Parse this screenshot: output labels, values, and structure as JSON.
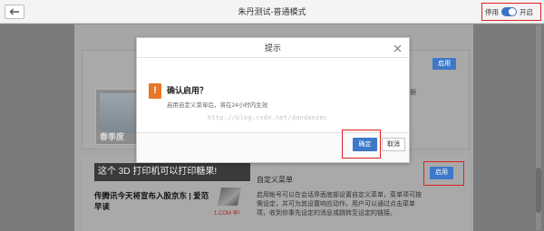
{
  "header": {
    "back_icon": "arrow-left-icon",
    "title": "朱丹测试-普通模式",
    "mode_off_label": "停用",
    "mode_on_label": "开启",
    "toggle_state": "on"
  },
  "cards": {
    "card1_button": "启用",
    "card1_image_caption": "春季度",
    "card1_trailing_text": "据",
    "card2": {
      "banner_text": "这个 3D 打印机可以打印糖果!",
      "news_title": "传腾讯今天将宣布入股京东 | 爱范早读",
      "logo_text": "1.COM 早!",
      "menu_title": "自定义菜单",
      "menu_description": "启用帐号可以在会话界面底部设置自定义菜单，菜单项可按需设定，并可为其设置响应动作。用户可以通过点击菜单项，收到你事先设定的消息或跳转至设定的链接。",
      "enable_button": "启用"
    }
  },
  "modal": {
    "title": "提示",
    "close_icon": "close-icon",
    "warning_icon": "exclamation-icon",
    "heading": "确认启用？",
    "message": "启用自定义菜单后，将在24小时内生效",
    "watermark": "http://blog.csdn.net/dandanzmc",
    "ok_label": "确定",
    "cancel_label": "取消"
  },
  "colors": {
    "accent": "#3e78c8",
    "warning": "#e8772a",
    "highlight_box": "#e02020"
  }
}
